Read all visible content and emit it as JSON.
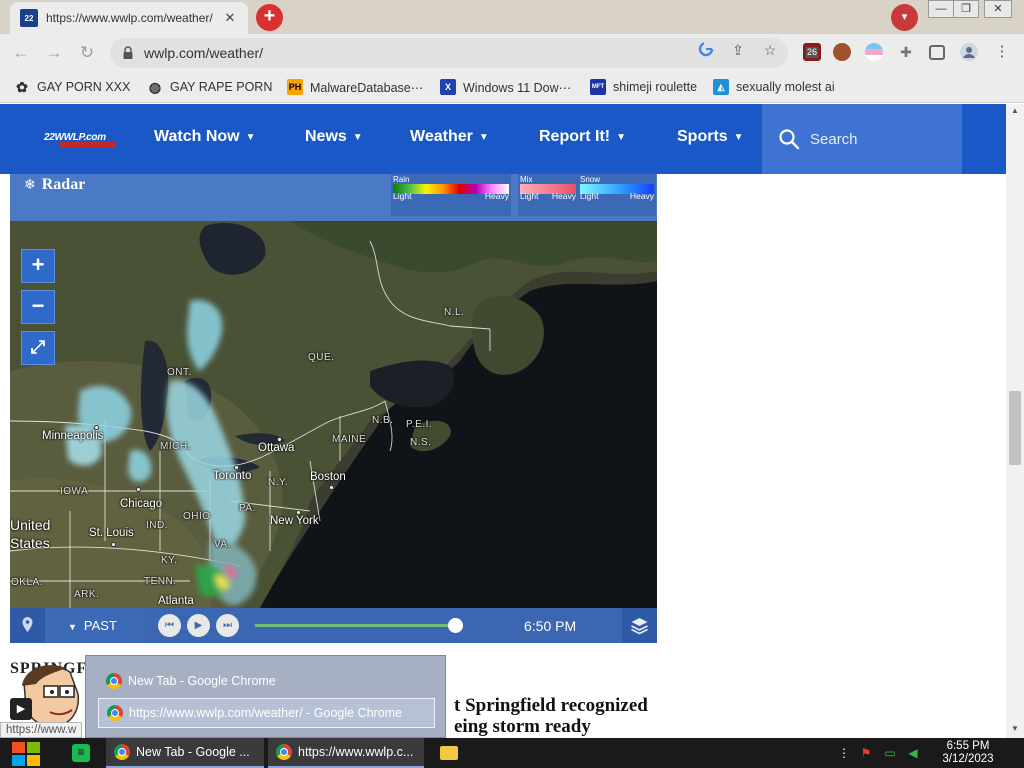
{
  "browser": {
    "tab_title": "https://www.wwlp.com/weather/",
    "tab_favicon_text": "22",
    "new_tab_symbol": "+",
    "tab_search_symbol": "▾",
    "address": "wwlp.com/weather/",
    "extension_badge": "26",
    "window_controls": [
      "—",
      "❐",
      "✕"
    ]
  },
  "bookmarks": [
    {
      "label": "GAY PORN XXX",
      "icon": "paw-icon"
    },
    {
      "label": "GAY RAPE PORN",
      "icon": "globe-icon"
    },
    {
      "label": "MalwareDatabase⋯",
      "icon": "ph-icon",
      "icon_text": "PH"
    },
    {
      "label": "Windows 11 Dow⋯",
      "icon": "x-icon",
      "icon_text": "X"
    },
    {
      "label": "shimeji roulette",
      "icon": "shimeji-icon",
      "icon_text": "MFT"
    },
    {
      "label": "sexually molest ai",
      "icon": "ai-icon"
    }
  ],
  "site": {
    "logo_text": "22WWLP.com",
    "nav": [
      {
        "label": "Watch Now",
        "caret": "▼"
      },
      {
        "label": "News",
        "caret": "▼"
      },
      {
        "label": "Weather",
        "caret": "▼"
      },
      {
        "label": "Report It!",
        "caret": "▼"
      },
      {
        "label": "Sports",
        "caret": "▼"
      }
    ],
    "search_placeholder": "Search"
  },
  "radar": {
    "title": "Radar",
    "legend": [
      {
        "name": "Rain",
        "low": "Light",
        "high": "Heavy"
      },
      {
        "name": "Mix",
        "low": "Light",
        "high": "Heavy"
      },
      {
        "name": "Snow",
        "low": "Light",
        "high": "Heavy"
      }
    ],
    "zoom_in": "+",
    "zoom_out": "−",
    "fullscreen": "⤢",
    "map_labels": {
      "nl": "N.L.",
      "que": "QUE.",
      "ont": "ONT.",
      "nb": "N.B.",
      "pei": "P.E.I.",
      "ns": "N.S.",
      "minneapolis": "Minneapolis",
      "mich": "MICH.",
      "ottawa": "Ottawa",
      "maine": "MAINE",
      "toronto": "Toronto",
      "ny": "N.Y.",
      "boston": "Boston",
      "iowa": "IOWA",
      "chicago": "Chicago",
      "ohio": "OHIO",
      "pa": "PA.",
      "newyork": "New York",
      "united": "United",
      "states": "States",
      "stlouis": "St. Louis",
      "ind": "IND.",
      "ky": "KY.",
      "va": "VA.",
      "tenn": "TENN.",
      "okla": "OKLA.",
      "ark": "ARK.",
      "atlanta": "Atlanta"
    },
    "mode": "PAST",
    "time": "6:50 PM",
    "timeline_progress": 0.96
  },
  "page": {
    "section_heading": "SPRINGF",
    "article_line1": "t Springfield recognized",
    "article_line2": "eing storm ready"
  },
  "status_url": "https://www.w",
  "taskbar_popup": [
    {
      "label": "New Tab - Google Chrome"
    },
    {
      "label": "https://www.wwlp.com/weather/ - Google Chrome"
    }
  ],
  "taskbar": {
    "apps": [
      {
        "label": "New Tab - Google ..."
      },
      {
        "label": "https://www.wwlp.c..."
      }
    ],
    "time": "6:55 PM",
    "date": "3/12/2023"
  },
  "colors": {
    "site_blue": "#1b58c7",
    "radar_blue": "#3c69b5",
    "tab_strip": "#d9d2c7"
  }
}
